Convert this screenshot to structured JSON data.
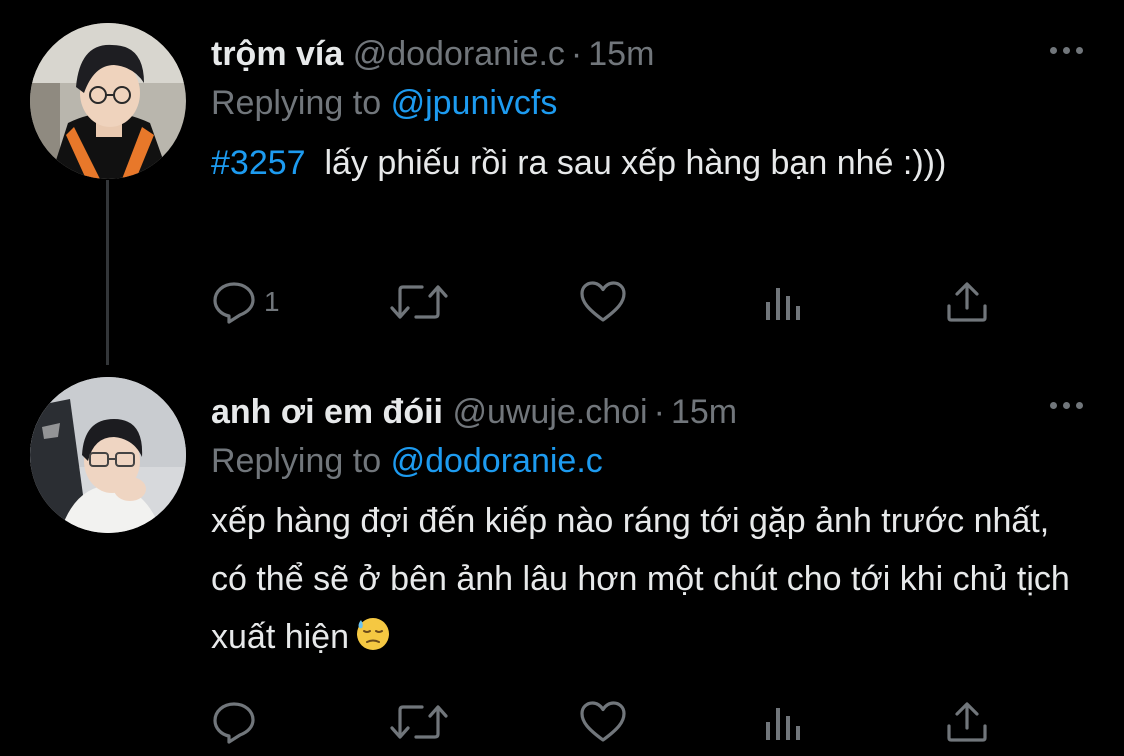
{
  "colors": {
    "background": "#000000",
    "text_primary": "#e7e9ea",
    "text_secondary": "#71767b",
    "link": "#1d9bf0",
    "thread_line": "#333639"
  },
  "tweets": [
    {
      "display_name": "trộm vía",
      "handle": "@dodoranie.c",
      "separator": "·",
      "time": "15m",
      "reply_prefix": "Replying to",
      "reply_to": "@jpunivcfs",
      "hashtag": "#3257",
      "text": "lấy phiếu rồi ra sau xếp hàng bạn nhé :)))",
      "actions": {
        "reply": {
          "icon": "reply-icon",
          "count": "1"
        },
        "retweet": {
          "icon": "retweet-icon"
        },
        "like": {
          "icon": "heart-icon"
        },
        "views": {
          "icon": "views-icon"
        },
        "share": {
          "icon": "share-icon"
        }
      },
      "more_icon": "more-icon",
      "avatar_icon": "avatar"
    },
    {
      "display_name": "anh ơi em đóii",
      "handle": "@uwuje.choi",
      "separator": "·",
      "time": "15m",
      "reply_prefix": "Replying to",
      "reply_to": "@dodoranie.c",
      "text": "xếp hàng đợi đến kiếp nào ráng tới gặp ảnh trước nhất, có thể sẽ ở bên ảnh lâu hơn một chút cho tới khi chủ tịch xuất hiện",
      "emoji": "downcast-face-with-sweat-emoji",
      "actions": {
        "reply": {
          "icon": "reply-icon"
        },
        "retweet": {
          "icon": "retweet-icon"
        },
        "like": {
          "icon": "heart-icon"
        },
        "views": {
          "icon": "views-icon"
        },
        "share": {
          "icon": "share-icon"
        }
      },
      "more_icon": "more-icon",
      "avatar_icon": "avatar"
    }
  ]
}
